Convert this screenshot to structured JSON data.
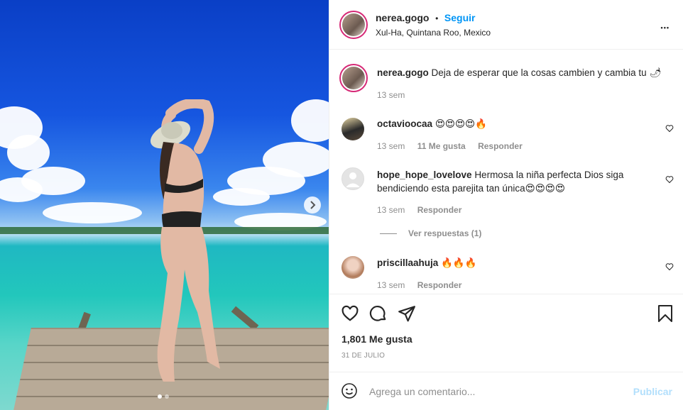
{
  "post": {
    "username": "nerea.gogo",
    "follow_label": "Seguir",
    "separator": "•",
    "location": "Xul-Ha, Quintana Roo, Mexico",
    "more_label": "•••"
  },
  "caption": {
    "username": "nerea.gogo",
    "text": "Deja de esperar que la cosas cambien y cambia tu",
    "emoji": "🌶",
    "time": "13 sem"
  },
  "comments": [
    {
      "username": "octavioocaa",
      "text": "😍😍😍😍🔥",
      "time": "13 sem",
      "likes": "11 Me gusta",
      "reply_label": "Responder"
    },
    {
      "username": "hope_hope_lovelove",
      "text": "Hermosa la niña perfecta Dios siga bendiciendo esta parejita tan única😍😍😍😍",
      "time": "13 sem",
      "reply_label": "Responder"
    },
    {
      "username": "priscillaahuja",
      "text": "🔥🔥🔥",
      "time": "13 sem",
      "reply_label": "Responder"
    }
  ],
  "view_replies": "Ver respuestas (1)",
  "likes_count": "1,801 Me gusta",
  "post_date": "31 DE JULIO",
  "add_comment": {
    "placeholder": "Agrega un comentario...",
    "publish_label": "Publicar"
  },
  "colors": {
    "accent": "#0095f6",
    "publish_disabled": "#b2dffc",
    "muted": "#8e8e8e"
  },
  "icons": [
    "chevron-right-icon",
    "more-icon",
    "heart-icon",
    "comment-icon",
    "share-icon",
    "bookmark-icon",
    "emoji-icon"
  ]
}
